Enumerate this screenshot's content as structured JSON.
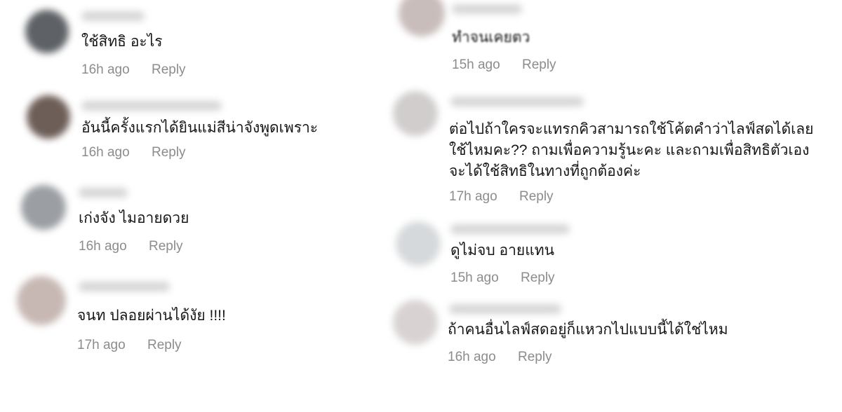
{
  "comments_left": [
    {
      "text": "ใช้สิทธิ อะไร",
      "time": "16h ago",
      "reply": "Reply"
    },
    {
      "text": "อันนี้ครั้งแรกได้ยินแม่สีน่าจังพูดเพราะ",
      "time": "16h ago",
      "reply": "Reply"
    },
    {
      "text": "เก่งจัง ไมอายดวย",
      "time": "16h ago",
      "reply": "Reply"
    },
    {
      "text": "จนท ปลอยผ่านได้งัย !!!!",
      "time": "17h ago",
      "reply": "Reply"
    }
  ],
  "comments_right": [
    {
      "text": "ทําจนเคยตว",
      "time": "15h ago",
      "reply": "Reply"
    },
    {
      "lines": [
        "ต่อไปถ้าใครจะแทรกคิวสามารถใช้โค้ตคําว่าไลฟ์สดได้เลย",
        "ใช้ไหมคะ?? ถามเพื่อความรู้นะคะ และถามเพื่อสิทธิตัวเอง",
        "จะได้ใช้สิทธิในทางที่ถูกต้องค่ะ"
      ],
      "time": "17h ago",
      "reply": "Reply"
    },
    {
      "text": "ดูไม่จบ อายแทน",
      "time": "15h ago",
      "reply": "Reply"
    },
    {
      "text": "ถ้าคนอื่นไลฟ์สดอยู่ก็แหวกไปแบบนี้ได้ใช่ไหม",
      "time": "16h ago",
      "reply": "Reply"
    }
  ],
  "colors": {
    "text": "#161616",
    "meta": "#8c8c8c",
    "background": "#ffffff"
  }
}
